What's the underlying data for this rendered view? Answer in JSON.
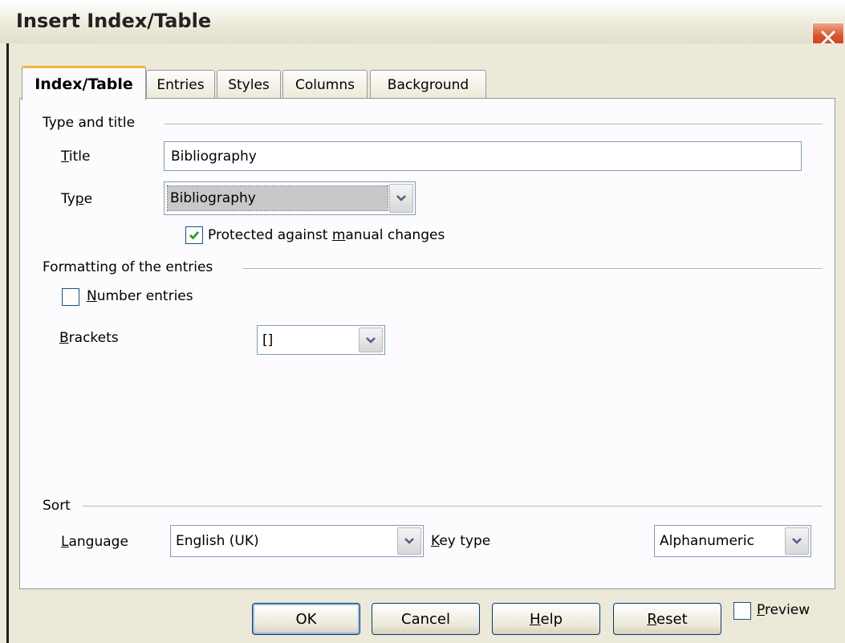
{
  "window": {
    "title": "Insert Index/Table"
  },
  "tabs": [
    {
      "label": "Index/Table",
      "active": true
    },
    {
      "label": "Entries",
      "active": false
    },
    {
      "label": "Styles",
      "active": false
    },
    {
      "label": "Columns",
      "active": false
    },
    {
      "label": "Background",
      "active": false
    }
  ],
  "type_and_title": {
    "group_label": "Type and title",
    "title_label": "Title",
    "title_value": "Bibliography",
    "type_label": "Type",
    "type_value": "Bibliography",
    "protected_label": "Protected against manual changes",
    "protected_checked": true
  },
  "formatting": {
    "group_label": "Formatting of the entries",
    "number_entries_label": "Number entries",
    "number_entries_checked": false,
    "brackets_label": "Brackets",
    "brackets_value": "[]"
  },
  "sort": {
    "group_label": "Sort",
    "language_label": "Language",
    "language_value": "English (UK)",
    "key_type_label": "Key type",
    "key_type_value": "Alphanumeric"
  },
  "buttons": {
    "ok": "OK",
    "cancel": "Cancel",
    "help": "Help",
    "reset": "Reset",
    "preview_label": "Preview",
    "preview_checked": false
  },
  "icons": {
    "close": "close-icon",
    "dropdown": "chevron-down-icon",
    "check": "checkmark-icon"
  },
  "colors": {
    "dialog_bg": "#ece9d8",
    "panel_bg": "#fcfcfe",
    "close_red": "#d9532c",
    "active_tab_accent": "#f5b23d",
    "check_green": "#21a121"
  }
}
